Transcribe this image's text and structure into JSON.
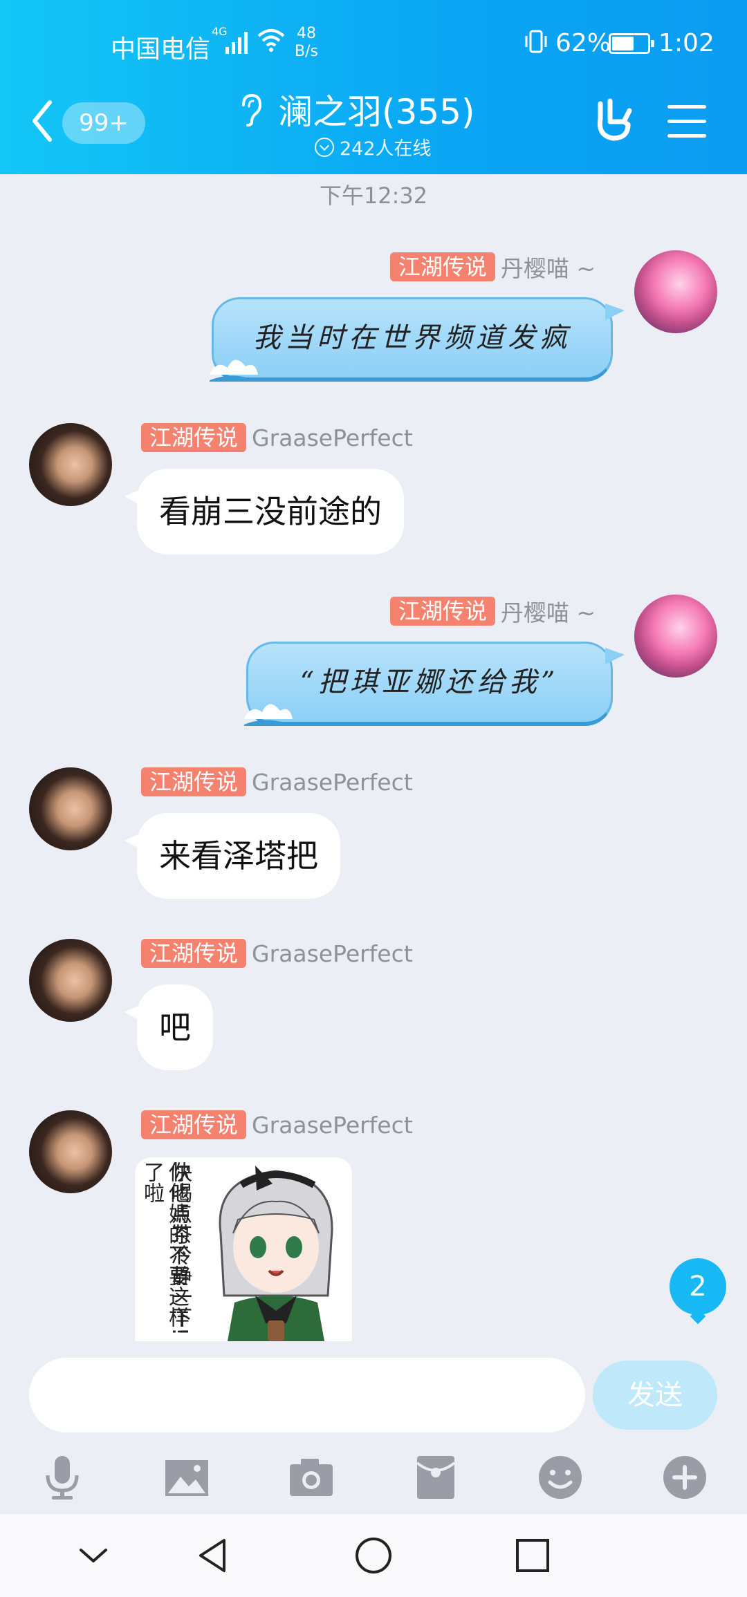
{
  "status_bar": {
    "carrier": "中国电信",
    "signal_label": "4G",
    "net_speed_value": "48",
    "net_speed_unit": "B/s",
    "battery_percent": "62%",
    "battery_level": 0.62,
    "time": "1:02"
  },
  "header": {
    "unread_count": "99+",
    "group_title": "澜之羽(355)",
    "online_count": "242人在线"
  },
  "chat": {
    "time_divider": "下午12:32",
    "messages": [
      {
        "direction": "out",
        "badge": "江湖传说",
        "sender": "丹樱喵 ~",
        "text": "我当时在世界频道发疯"
      },
      {
        "direction": "in",
        "badge": "江湖传说",
        "sender": "GraasePerfect",
        "text": "看崩三没前途的"
      },
      {
        "direction": "out",
        "badge": "江湖传说",
        "sender": "丹樱喵 ~",
        "text": "“把琪亚娜还给我”"
      },
      {
        "direction": "in",
        "badge": "江湖传说",
        "sender": "GraasePerfect",
        "text": "来看泽塔把"
      },
      {
        "direction": "in",
        "badge": "江湖传说",
        "sender": "GraasePerfect",
        "text": "吧"
      },
      {
        "direction": "in",
        "badge": "江湖传说",
        "sender": "GraasePerfect",
        "sticker_lines": [
          "快喝点茶冷静一下!",
          "你他媽的不要这样了啦"
        ]
      }
    ],
    "new_message_count": "2"
  },
  "input": {
    "value": "",
    "send_label": "发送"
  },
  "toolbar_icons": [
    "microphone-icon",
    "image-icon",
    "camera-icon",
    "red-packet-icon",
    "emoji-icon",
    "plus-icon"
  ],
  "nav_icons": [
    "chevron-down-icon",
    "back-triangle-icon",
    "home-circle-icon",
    "recents-square-icon"
  ],
  "colors": {
    "header_start": "#13c6f6",
    "header_end": "#0b9cf1",
    "badge": "#f5826f",
    "chat_bg": "#eceef5",
    "send_disabled": "#bfe8fb",
    "icon_gray": "#9a9ca6"
  }
}
